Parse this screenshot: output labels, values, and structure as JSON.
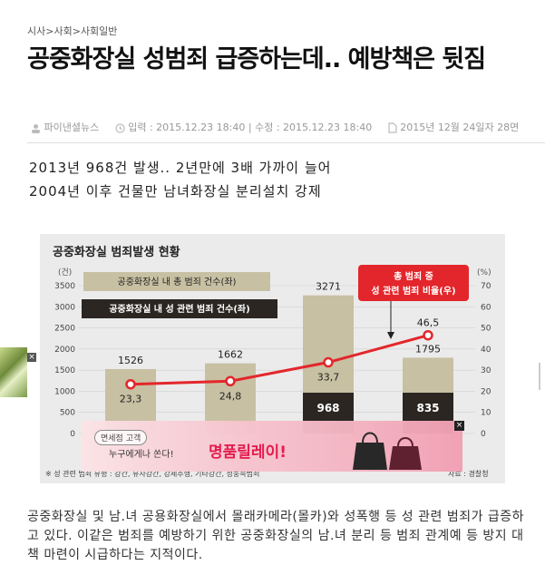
{
  "breadcrumb": [
    "시사",
    "사회",
    "사회일반"
  ],
  "breadcrumb_sep": ">",
  "article": {
    "title": "공중화장실 성범죄 급증하는데.. 예방책은 뒷짐",
    "author": "파이낸셜뉴스",
    "published": "입력 : 2015.12.23 18:40",
    "modified": "수정 : 2015.12.23 18:40",
    "print_edition": "2015년 12월 24일자 28면",
    "subhead_1": "2013년 968건 발생.. 2년만에 3배 가까이 늘어",
    "subhead_2": "2004년 이후 건물만 남녀화장실 분리설치 강제",
    "body": "공중화장실 및 남.녀 공용화장실에서 몰래카메라(몰카)와 성폭행 등 성 관련 범죄가 급증하고 있다. 이같은 범죄를 예방하기 위한 공중화장실의 남.녀 분리 등 범죄 관계예 등 방지 대책 마련이 시급하다는 지적이다."
  },
  "chart_data": {
    "type": "bar",
    "title": "공중화장실 범죄발생 현황",
    "left_axis_unit": "(건)",
    "right_axis_unit": "(%)",
    "left_ticks": [
      3500,
      3000,
      2500,
      2000,
      1500,
      1000,
      500,
      0
    ],
    "right_ticks": [
      70,
      60,
      50,
      40,
      30,
      20,
      10,
      0
    ],
    "ylim": [
      0,
      3500
    ],
    "y2lim": [
      0,
      70
    ],
    "legend_total": "공중화장실 내 총 범죄 건수(좌)",
    "legend_sex": "공중화장실 내 성 관련 범죄 건수(좌)",
    "callout_line1": "총 범죄 중",
    "callout_line2": "성 관련 범죄 비율(우)",
    "series": [
      {
        "name": "공중화장실 내 총 범죄 건수(좌)",
        "values": [
          1526,
          1662,
          3271,
          1795
        ]
      },
      {
        "name": "공중화장실 내 성 관련 범죄 건수(좌)",
        "values_labels": [
          "",
          "",
          "968",
          "835"
        ]
      },
      {
        "name": "총 범죄 중 성 관련 범죄 비율(우)",
        "values": [
          23.3,
          24.8,
          33.7,
          46.5
        ]
      }
    ],
    "total_labels": [
      "1526",
      "1662",
      "3271",
      "1795"
    ],
    "rate_labels": [
      "23,3",
      "24,8",
      "33,7",
      "46,5"
    ],
    "footnote": "※ 성 관련 범죄 유형 : 강간, 유사강간, 강제추행, 기타강간, 성풍속범죄",
    "source": "자료 : 경찰청",
    "colors": {
      "total_bar": "#c8c0a3",
      "sex_bar": "#2b2622",
      "line": "#e3262b",
      "callout": "#e3262b"
    }
  },
  "ads": {
    "banner_tag": "면세점 고객",
    "banner_sub": "누구에게나 쏜다!",
    "banner_brand": "명품릴레이!",
    "close_label": "×",
    "side_close_label": "×"
  },
  "icons": [
    "person-icon",
    "clock-icon",
    "document-icon"
  ]
}
